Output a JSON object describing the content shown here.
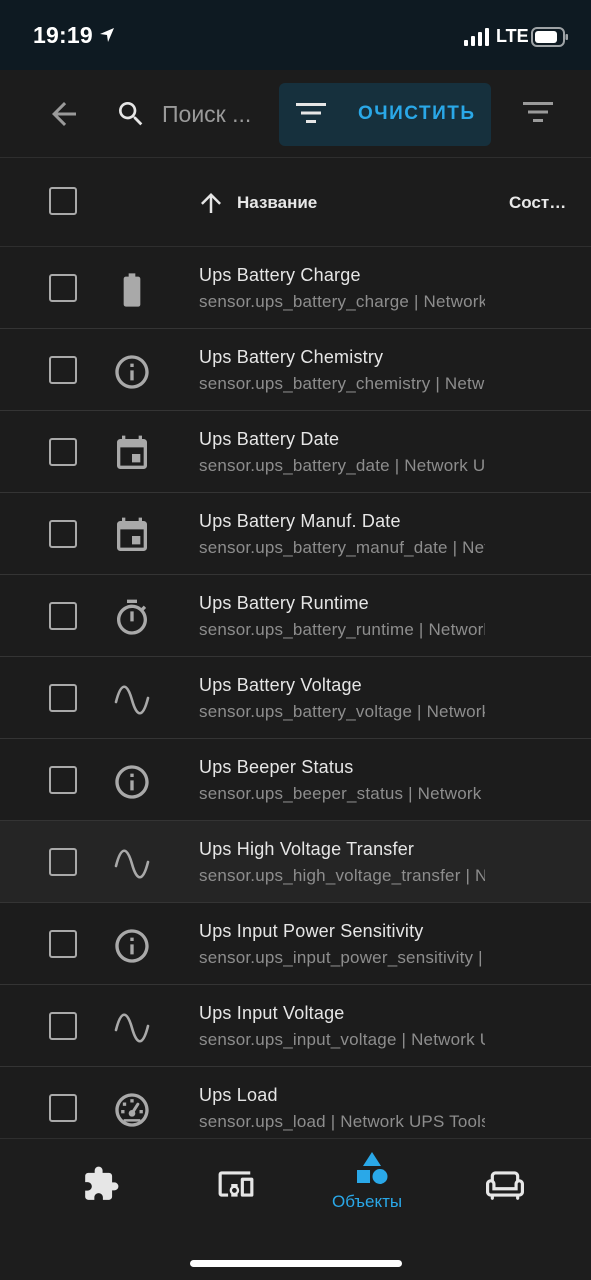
{
  "status_bar": {
    "time": "19:19",
    "network": "LTE",
    "icons": [
      "location-arrow-icon",
      "signal-icon",
      "battery-icon"
    ]
  },
  "toolbar": {
    "back_icon": "arrow-left-icon",
    "search_icon": "search-icon",
    "search_placeholder": "Поиск ...",
    "clear_label": "ОЧИСТИТЬ",
    "clear_icon": "filter-lines-icon",
    "filter_icon": "filter-lines-icon"
  },
  "table": {
    "sort_icon": "arrow-up-icon",
    "col_name": "Название",
    "col_state": "Сост…",
    "rows": [
      {
        "title": "Ups Battery Charge",
        "subtitle": "sensor.ups_battery_charge | Network UPS Tools",
        "icon": "battery-icon",
        "highlighted": false
      },
      {
        "title": "Ups Battery Chemistry",
        "subtitle": "sensor.ups_battery_chemistry | Network UPS Tools",
        "icon": "info-circle-icon",
        "highlighted": false
      },
      {
        "title": "Ups Battery Date",
        "subtitle": "sensor.ups_battery_date | Network UPS Tools",
        "icon": "calendar-icon",
        "highlighted": false
      },
      {
        "title": "Ups Battery Manuf. Date",
        "subtitle": "sensor.ups_battery_manuf_date | Network UPS Tools",
        "icon": "calendar-icon",
        "highlighted": false
      },
      {
        "title": "Ups Battery Runtime",
        "subtitle": "sensor.ups_battery_runtime | Network UPS Tools",
        "icon": "timer-icon",
        "highlighted": false
      },
      {
        "title": "Ups Battery Voltage",
        "subtitle": "sensor.ups_battery_voltage | Network UPS Tools",
        "icon": "sine-wave-icon",
        "highlighted": false
      },
      {
        "title": "Ups Beeper Status",
        "subtitle": "sensor.ups_beeper_status | Network UPS Tools",
        "icon": "info-circle-icon",
        "highlighted": false
      },
      {
        "title": "Ups High Voltage Transfer",
        "subtitle": "sensor.ups_high_voltage_transfer | Network UPS Tools",
        "icon": "sine-wave-icon",
        "highlighted": true
      },
      {
        "title": "Ups Input Power Sensitivity",
        "subtitle": "sensor.ups_input_power_sensitivity | Network UPS Tools",
        "icon": "info-circle-icon",
        "highlighted": false
      },
      {
        "title": "Ups Input Voltage",
        "subtitle": "sensor.ups_input_voltage | Network UPS Tools",
        "icon": "sine-wave-icon",
        "highlighted": false
      },
      {
        "title": "Ups Load",
        "subtitle": "sensor.ups_load | Network UPS Tools",
        "icon": "gauge-icon",
        "highlighted": false
      }
    ]
  },
  "bottom_nav": {
    "items": [
      {
        "icon": "puzzle-icon",
        "label": "",
        "active": false
      },
      {
        "icon": "devices-icon",
        "label": "",
        "active": false
      },
      {
        "icon": "shapes-icon",
        "label": "Объекты",
        "active": true
      },
      {
        "icon": "sofa-icon",
        "label": "",
        "active": false
      }
    ]
  },
  "colors": {
    "accent": "#2aa8e8",
    "background": "#1c1c1c",
    "status_bar": "#0e1a22",
    "clear_button_bg": "#16303d",
    "icon": "#a9a9a9"
  }
}
